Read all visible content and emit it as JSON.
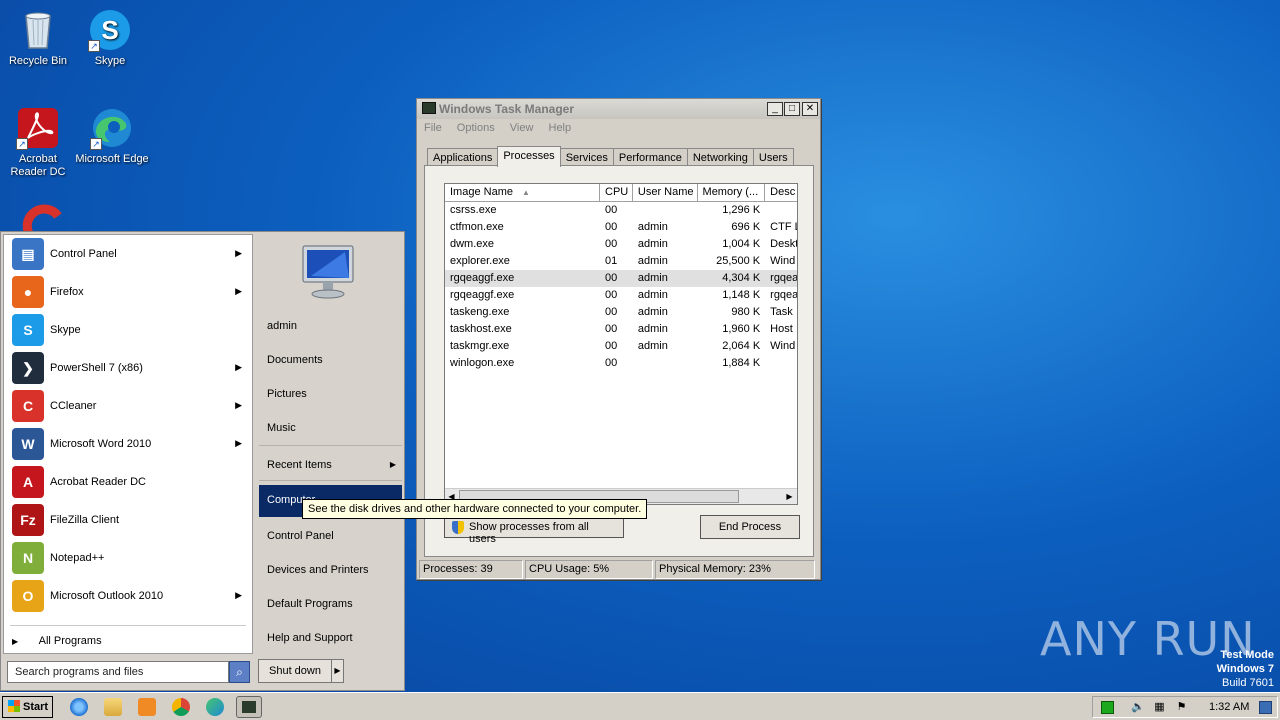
{
  "desktop": {
    "icons": [
      {
        "label": "Recycle Bin",
        "icon": "recycle-bin-icon"
      },
      {
        "label": "Skype",
        "icon": "skype-icon"
      },
      {
        "label": "Acrobat Reader DC",
        "icon": "acrobat-icon"
      },
      {
        "label": "Microsoft Edge",
        "icon": "edge-icon"
      }
    ]
  },
  "start_menu": {
    "programs": [
      {
        "label": "Control Panel",
        "has_submenu": true,
        "icon": "control-panel-icon"
      },
      {
        "label": "Firefox",
        "has_submenu": true,
        "icon": "firefox-icon"
      },
      {
        "label": "Skype",
        "has_submenu": false,
        "icon": "skype-icon"
      },
      {
        "label": "PowerShell 7 (x86)",
        "has_submenu": true,
        "icon": "powershell-icon"
      },
      {
        "label": "CCleaner",
        "has_submenu": true,
        "icon": "ccleaner-icon"
      },
      {
        "label": "Microsoft Word 2010",
        "has_submenu": true,
        "icon": "word-icon"
      },
      {
        "label": "Acrobat Reader DC",
        "has_submenu": false,
        "icon": "acrobat-icon"
      },
      {
        "label": "FileZilla Client",
        "has_submenu": false,
        "icon": "filezilla-icon"
      },
      {
        "label": "Notepad++",
        "has_submenu": false,
        "icon": "notepadpp-icon"
      },
      {
        "label": "Microsoft Outlook 2010",
        "has_submenu": true,
        "icon": "outlook-icon"
      }
    ],
    "all_programs": "All Programs",
    "search_placeholder": "Search programs and files",
    "right": {
      "user": "admin",
      "documents": "Documents",
      "pictures": "Pictures",
      "music": "Music",
      "recent_items": "Recent Items",
      "computer": "Computer",
      "control_panel": "Control Panel",
      "devices_printers": "Devices and Printers",
      "default_programs": "Default Programs",
      "help_support": "Help and Support"
    },
    "shutdown": "Shut down",
    "tooltip": "See the disk drives and other hardware connected to your computer."
  },
  "task_manager": {
    "title": "Windows Task Manager",
    "menu": [
      "File",
      "Options",
      "View",
      "Help"
    ],
    "tabs": [
      "Applications",
      "Processes",
      "Services",
      "Performance",
      "Networking",
      "Users"
    ],
    "active_tab": "Processes",
    "columns": [
      "Image Name",
      "CPU",
      "User Name",
      "Memory (...",
      "Desc"
    ],
    "processes": [
      {
        "name": "csrss.exe",
        "cpu": "00",
        "user": "",
        "mem": "1,296 K",
        "desc": ""
      },
      {
        "name": "ctfmon.exe",
        "cpu": "00",
        "user": "admin",
        "mem": "696 K",
        "desc": "CTF L"
      },
      {
        "name": "dwm.exe",
        "cpu": "00",
        "user": "admin",
        "mem": "1,004 K",
        "desc": "Deskt"
      },
      {
        "name": "explorer.exe",
        "cpu": "01",
        "user": "admin",
        "mem": "25,500 K",
        "desc": "Wind"
      },
      {
        "name": "rgqeaggf.exe",
        "cpu": "00",
        "user": "admin",
        "mem": "4,304 K",
        "desc": "rgqea"
      },
      {
        "name": "rgqeaggf.exe",
        "cpu": "00",
        "user": "admin",
        "mem": "1,148 K",
        "desc": "rgqea"
      },
      {
        "name": "taskeng.exe",
        "cpu": "00",
        "user": "admin",
        "mem": "980 K",
        "desc": "Task"
      },
      {
        "name": "taskhost.exe",
        "cpu": "00",
        "user": "admin",
        "mem": "1,960 K",
        "desc": "Host"
      },
      {
        "name": "taskmgr.exe",
        "cpu": "00",
        "user": "admin",
        "mem": "2,064 K",
        "desc": "Wind"
      },
      {
        "name": "winlogon.exe",
        "cpu": "00",
        "user": "",
        "mem": "1,884 K",
        "desc": ""
      }
    ],
    "selected_row": 4,
    "show_all_button": "Show processes from all users",
    "end_process_button": "End Process",
    "status": {
      "processes": "Processes: 39",
      "cpu": "CPU Usage: 5%",
      "memory": "Physical Memory: 23%"
    }
  },
  "taskbar": {
    "start_label": "Start",
    "clock": "1:32 AM"
  },
  "watermark": {
    "brand": "ANY RUN",
    "test_mode": "Test Mode",
    "os": "Windows 7",
    "build": "Build 7601"
  }
}
